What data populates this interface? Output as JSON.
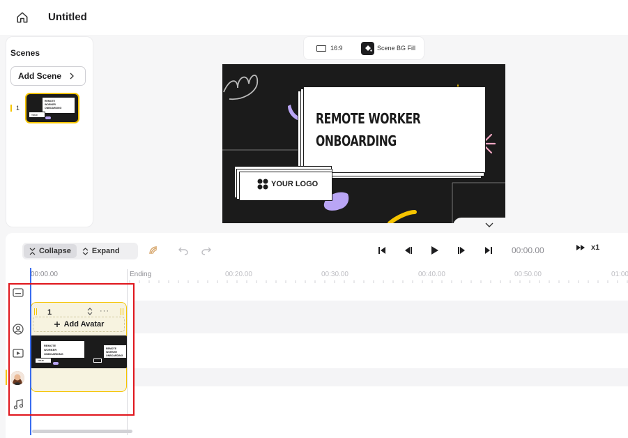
{
  "header": {
    "title": "Untitled",
    "home_icon": "home-icon"
  },
  "scenes_panel": {
    "title": "Scenes",
    "add_scene_label": "Add Scene",
    "scenes": [
      {
        "number": "1",
        "thumb_title": "REMOTE WORKER ONBOARDING",
        "thumb_logo": "YOUR LOGO"
      }
    ]
  },
  "canvas_toolbar": {
    "ratio_label": "16:9",
    "bg_fill_label": "Scene BG Fill"
  },
  "preview": {
    "title_line1": "REMOTE WORKER",
    "title_line2": "ONBOARDING",
    "logo_text": "YOUR LOGO",
    "background_color": "#1b1b1b",
    "accent_purple": "#b9a5f5",
    "accent_yellow": "#f5c400",
    "accent_pink": "#f2a7c3"
  },
  "timeline": {
    "collapse_label": "Collapse",
    "expand_label": "Expand",
    "time_readout": "00:00.00",
    "speed_label": "x1",
    "ruler": {
      "start": "00:00.00",
      "ending_label": "Ending",
      "ticks": [
        "00:20.00",
        "00:30.00",
        "00:40.00",
        "00:50.00",
        "01:00"
      ]
    },
    "scene_block": {
      "number": "1",
      "add_avatar_label": "Add Avatar",
      "thumb_title": "REMOTE WORKER ONBOARDING",
      "thumb_logo": "YOUR LOGO"
    },
    "track_icons": [
      "subtitle-icon",
      "avatar-track-icon",
      "video-track-icon",
      "avatar-photo",
      "music-icon"
    ]
  },
  "colors": {
    "highlight": "#e0151c",
    "playhead": "#3a6df0",
    "selection": "#f5c400"
  }
}
